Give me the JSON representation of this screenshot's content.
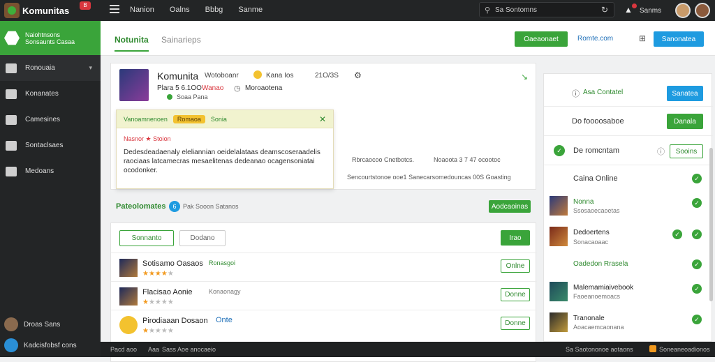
{
  "app": {
    "name": "Komunitas",
    "badge": "B"
  },
  "topnav": [
    "Nanion",
    "Oalns",
    "Bbbg",
    "Sanme"
  ],
  "search": {
    "text": "Sa Sontomns"
  },
  "user": {
    "name": "Sanms"
  },
  "sidebar": {
    "hero": {
      "line1": "Naiohtnsons",
      "line2": "Sonsaunts Casaa"
    },
    "items": [
      {
        "label": "Ronouaia",
        "icon": "home-icon"
      },
      {
        "label": "Konanates",
        "icon": "user-icon"
      },
      {
        "label": "Camesines",
        "icon": "game-icon"
      },
      {
        "label": "Sontaclsaes",
        "icon": "list-icon"
      },
      {
        "label": "Medoans",
        "icon": "check-icon"
      }
    ],
    "footer": [
      {
        "label": "Droas Sans"
      },
      {
        "label": "Kadcisfobsf cons"
      }
    ]
  },
  "tabs": [
    "Notunita",
    "Sainarieps"
  ],
  "header_actions": {
    "green": "Oaeaonaet",
    "link": "Romte.com",
    "blue": "Sanonatea"
  },
  "game": {
    "title": "Komunita",
    "subtitle": "Wotoboanr",
    "tags": "Kana  Ios",
    "score": "21O/3S",
    "line2a": "Plara 5  6.1OO",
    "line2b": "Wanao",
    "line2c": "Moroaotena",
    "line3": "Soaa Pana",
    "desc1": "Rbrcaocoo Cnetbotcs.",
    "desc2": "Noaoota 3 7 47 ocootoc",
    "desc3": "Sencourtstonoe ooe1 Sanecarsomedouncas 00S Goasting"
  },
  "popup": {
    "head_label": "Vanoamnenoen",
    "chip": "Romaoa",
    "head_tail": "Sonia",
    "sub": "Nasnor ★ Stoion",
    "body": "Dedesdeadaenaly eleliannian oeidelalataas deamscoseraadelis raociaas latcamecras mesaelitenas dedeanao ocagensoniatai ocodonker."
  },
  "section": {
    "title": "Pateolomates",
    "count": "6",
    "subtitle": "Pak Sooon Satanos",
    "btn": "Aodcaoinas"
  },
  "list": {
    "btn_primary": "Sonnanto",
    "btn_secondary": "Dodano",
    "btn_add": "Irao",
    "rows": [
      {
        "title": "Sotisamo Oasaos",
        "meta": "Ronasgoi",
        "rating": 4,
        "action": "Onlne"
      },
      {
        "title": "Flacisao Aonie",
        "meta": "Konaonagy",
        "rating": 1,
        "action": "Donne"
      },
      {
        "title": "Pirodiaaan Dosaon",
        "meta": "Onte",
        "rating": 1,
        "action": "Donne"
      }
    ]
  },
  "right": {
    "rows": [
      {
        "label": "Asa Contatel",
        "btn": "Sanatea"
      },
      {
        "label": "Do foooosaboe",
        "btn": "Danala"
      },
      {
        "label": "De romcntam",
        "btn": "Sooins"
      }
    ],
    "online_title": "Caina Online",
    "members": [
      {
        "name": "Nonna",
        "sub": "Ssosaoecaoetas"
      },
      {
        "name": "Dedoertens",
        "sub": "Sonacaoaac"
      },
      {
        "name": "Oadedon Rrasela",
        "sub": ""
      },
      {
        "name": "Malemamiaivebook",
        "sub": "Faoeanoemoacs"
      },
      {
        "name": "Tranonale",
        "sub": "Aoacaemcaonana"
      }
    ]
  },
  "statusbar": {
    "left": "Pacd aoo",
    "mid": "Aaa",
    "mid2": "Sass Aoe anocaeio",
    "right1": "Sa Saotononoe aotaons",
    "right2": "Soneaneoadionos"
  },
  "colors": {
    "green": "#3aa43a",
    "blue": "#1e9be0",
    "star": "#f29a1f",
    "dark": "#232526"
  }
}
